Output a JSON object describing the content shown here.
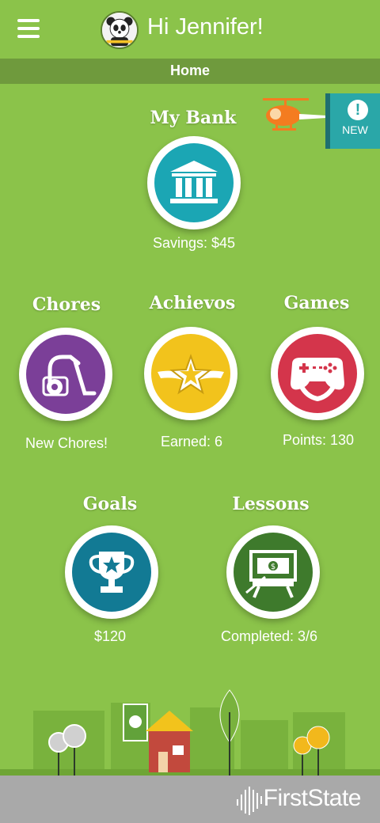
{
  "header": {
    "greeting": "Hi Jennifer!",
    "menu_icon": "hamburger-menu-icon",
    "avatar_icon": "panda-avatar"
  },
  "subheader": {
    "title": "Home"
  },
  "notification": {
    "label": "NEW",
    "icon": "exclamation-icon"
  },
  "tiles": {
    "bank": {
      "title": "My Bank",
      "caption": "Savings: $45",
      "color": "#1ba6b4",
      "icon": "bank-icon"
    },
    "chores": {
      "title": "Chores",
      "caption": "New Chores!",
      "color": "#7b3f98",
      "icon": "vacuum-icon"
    },
    "achievos": {
      "title": "Achievos",
      "caption": "Earned: 6",
      "color": "#f2c31c",
      "icon": "winged-star-icon"
    },
    "games": {
      "title": "Games",
      "caption": "Points: 130",
      "color": "#d4354b",
      "icon": "game-controller-icon"
    },
    "goals": {
      "title": "Goals",
      "caption": "$120",
      "color": "#127a94",
      "icon": "trophy-icon"
    },
    "lessons": {
      "title": "Lessons",
      "caption": "Completed: 3/6",
      "color": "#3e7a2c",
      "icon": "money-lesson-board-icon"
    }
  },
  "footer": {
    "brand": "FirstState",
    "brand_icon": "firststate-logo-icon"
  }
}
